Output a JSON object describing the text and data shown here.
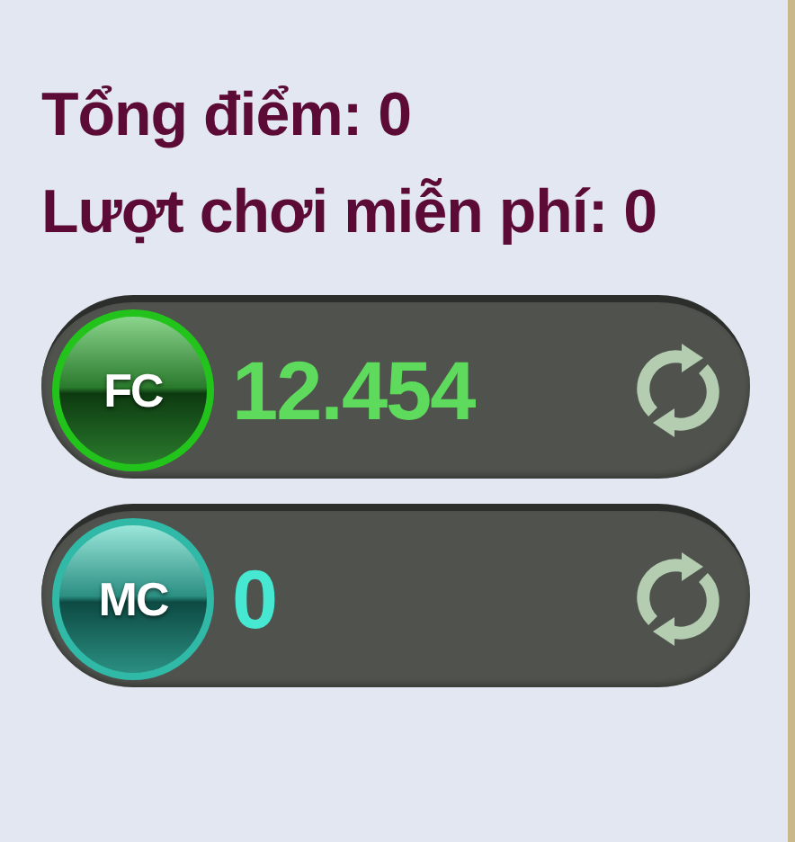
{
  "summary": [
    {
      "label": "Tổng điểm: 0"
    },
    {
      "label": "Lượt chơi miễn phí: 0"
    }
  ],
  "balances": [
    {
      "kind": "fc",
      "coin": "FC",
      "value": "12.454",
      "color": "#5edb5c"
    },
    {
      "kind": "mc",
      "coin": "MC",
      "value": "0",
      "color": "#46e8d2"
    }
  ]
}
